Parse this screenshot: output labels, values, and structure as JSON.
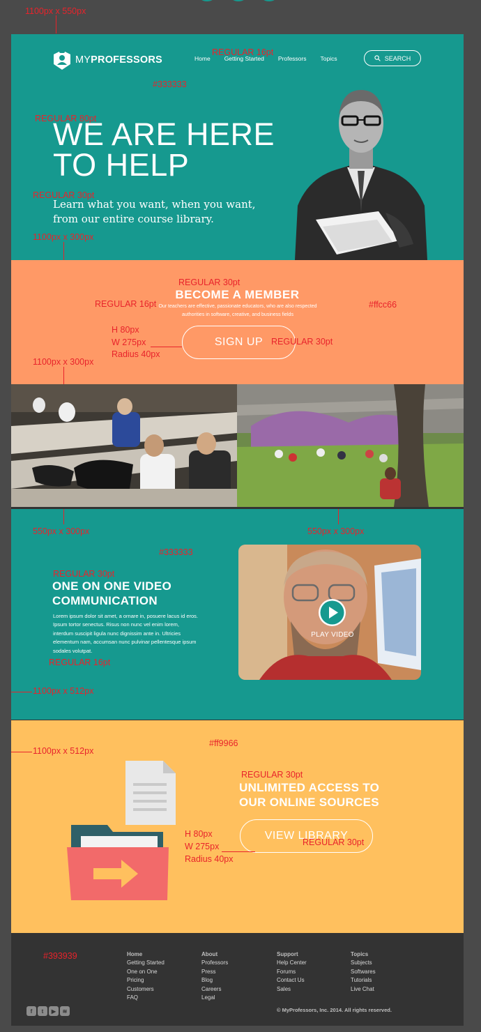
{
  "colors": {
    "teal": "#16998f",
    "orange": "#ff9966",
    "yellow": "#ffc05e",
    "dark": "#333333",
    "annotation": "#e8232b"
  },
  "header": {
    "logo_prefix": "MY",
    "logo_bold": "PROFESSORS",
    "nav": [
      "Home",
      "Getting Started",
      "Professors",
      "Topics"
    ],
    "search_label": "SEARCH"
  },
  "hero": {
    "title_line1": "WE ARE HERE",
    "title_line2": "TO HELP",
    "subtitle": "Learn what you want, when you want, from our entire course library."
  },
  "member": {
    "title": "BECOME A MEMBER",
    "description": "Our teachers are effective, passionate educators, who are also respected authorities in software, creative, and business fields",
    "button": "SIGN UP"
  },
  "video": {
    "title_line1": "ONE ON ONE VIDEO",
    "title_line2": "COMMUNICATION",
    "body": "Lorem ipsum dolor sit amet, a ornare in, posuere lacus id eros. Ipsum tortor senectus. Risus non nunc vel enim lorem, interdum suscipit ligula nunc dignissim ante in. Ultricies elementum nam, accumsan nunc pulvinar pellentesque ipsum sodales volutpat.",
    "play_label": "PLAY VIDEO"
  },
  "library": {
    "title_line1": "UNLIMITED ACCESS TO",
    "title_line2": "OUR ONLINE SOURCES",
    "button": "VIEW LIBRARY"
  },
  "footer": {
    "columns": [
      {
        "heading": "Home",
        "links": [
          "Getting Started",
          "One on One",
          "Pricing",
          "Customers",
          "FAQ"
        ]
      },
      {
        "heading": "About",
        "links": [
          "Professors",
          "Press",
          "Blog",
          "Careers",
          "Legal"
        ]
      },
      {
        "heading": "Support",
        "links": [
          "Help Center",
          "Forums",
          "Contact Us",
          "Sales"
        ]
      },
      {
        "heading": "Topics",
        "links": [
          "Subjects",
          "Softwares",
          "Tutorials",
          "Live Chat"
        ]
      }
    ],
    "copyright": "© MyProfessors, Inc. 2014. All rights reserved.",
    "social_icons": [
      "facebook-icon",
      "twitter-icon",
      "youtube-icon",
      "rss-icon"
    ]
  },
  "annotations": {
    "a1": "1100px x 550px",
    "a2": "REGULAR 16pt",
    "a3": "#333333",
    "a4": "REGULAR 80pt",
    "a5": "REGULAR 30pt",
    "a6": "1100px x 300px",
    "a7": "REGULAR 30pt",
    "a8": "REGULAR 16pt",
    "a9": "#ffcc66",
    "a10": "H 80px",
    "a11": "W 275px",
    "a12": "Radius 40px",
    "a13": "REGULAR 30pt",
    "a14": "1100px x 300px",
    "a15": "550px x 300px",
    "a16": "550px x 300px",
    "a17": "#333333",
    "a18": "REGULAR 30pt",
    "a19": "REGULAR 16pt",
    "a20": "1100px x 512px",
    "a21": "1100px x 512px",
    "a22": "#ff9966",
    "a23": "REGULAR 30pt",
    "a24": "H 80px",
    "a25": "W 275px",
    "a26": "Radius 40px",
    "a27": "REGULAR 30pt",
    "a28": "#393939"
  }
}
